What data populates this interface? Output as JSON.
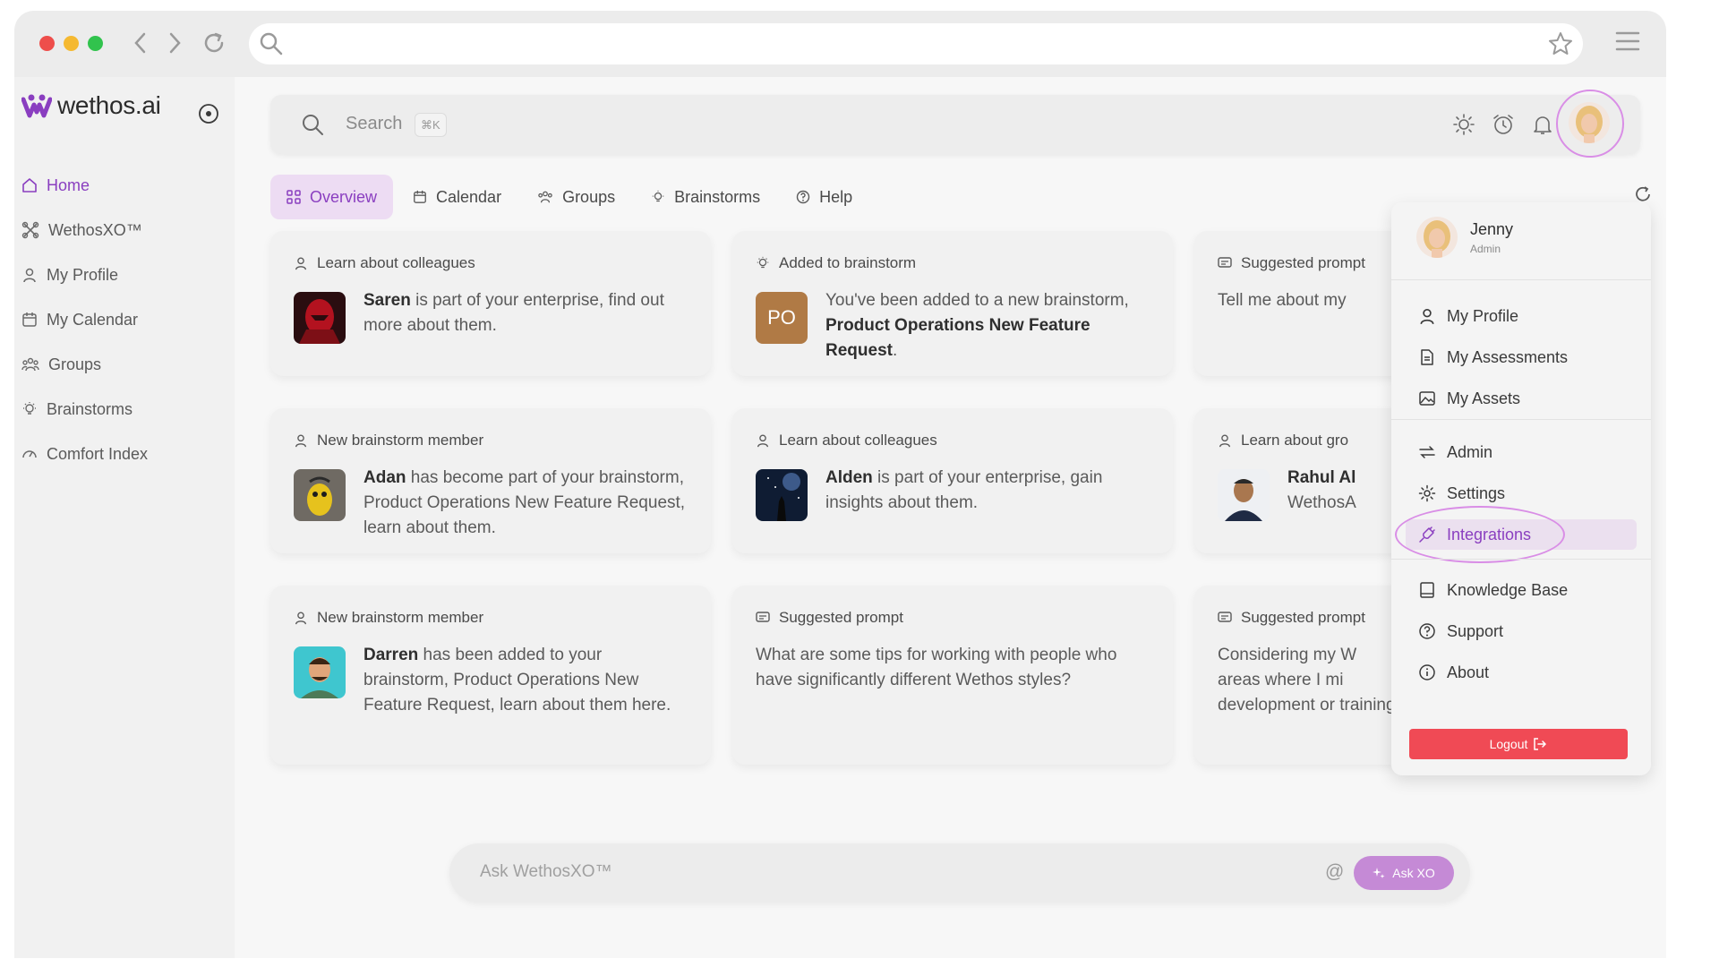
{
  "app": {
    "logo_text": "wethos.ai",
    "brand_color": "#8a3ec0"
  },
  "sidebar": {
    "items": [
      {
        "label": "Home",
        "icon": "home-icon",
        "active": true
      },
      {
        "label": "WethosXO™",
        "icon": "xo-icon"
      },
      {
        "label": "My Profile",
        "icon": "user-icon"
      },
      {
        "label": "My Calendar",
        "icon": "calendar-icon"
      },
      {
        "label": "Groups",
        "icon": "groups-icon"
      },
      {
        "label": "Brainstorms",
        "icon": "bulb-icon"
      },
      {
        "label": "Comfort Index",
        "icon": "gauge-icon"
      }
    ]
  },
  "search": {
    "placeholder": "Search",
    "shortcut": "⌘K"
  },
  "tabs": [
    {
      "label": "Overview",
      "active": true
    },
    {
      "label": "Calendar"
    },
    {
      "label": "Groups"
    },
    {
      "label": "Brainstorms"
    },
    {
      "label": "Help"
    }
  ],
  "cards": [
    {
      "header": "Learn about colleagues",
      "name": "Saren",
      "text": " is part of your enterprise, find out more about them."
    },
    {
      "header": "Added to brainstorm",
      "initials": "PO",
      "text_pre": "You've been added to a new brainstorm, ",
      "bold": "Product Operations New Feature Request",
      "text_post": "."
    },
    {
      "header": "Suggested prompt",
      "text": "Tell me about my"
    },
    {
      "header": "New brainstorm member",
      "name": "Adan",
      "text": " has become part of your brainstorm, Product Operations New Feature Request, learn about them."
    },
    {
      "header": "Learn about colleagues",
      "name": "Alden",
      "text": " is part of your enterprise, gain insights about them."
    },
    {
      "header": "Learn about gro",
      "name": "Rahul Al",
      "text": "WethosA"
    },
    {
      "header": "New brainstorm member",
      "name": "Darren",
      "text": " has been added to your brainstorm, Product Operations New Feature Request, learn about them here."
    },
    {
      "header": "Suggested prompt",
      "text": "What are some tips for working with people who have significantly different Wethos styles?"
    },
    {
      "header": "Suggested prompt",
      "line1": "Considering my W",
      "line2": "areas where I mi",
      "line3": "development or training?"
    }
  ],
  "dropdown": {
    "user_name": "Jenny",
    "user_role": "Admin",
    "items": [
      {
        "label": "My Profile"
      },
      {
        "label": "My Assessments"
      },
      {
        "label": "My Assets"
      },
      {
        "label": "Admin"
      },
      {
        "label": "Settings"
      },
      {
        "label": "Integrations",
        "active": true
      },
      {
        "label": "Knowledge Base"
      },
      {
        "label": "Support"
      },
      {
        "label": "About"
      }
    ],
    "logout_label": "Logout"
  },
  "ask": {
    "placeholder": "Ask WethosXO™",
    "button_label": "Ask XO"
  }
}
